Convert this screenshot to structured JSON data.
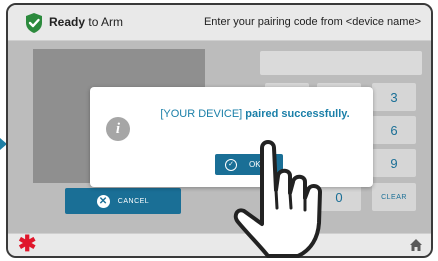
{
  "header": {
    "status_bold": "Ready",
    "status_rest": " to Arm",
    "prompt": "Enter your pairing code from <device name>"
  },
  "camera": {
    "cancel_label": "CANCEL"
  },
  "keypad": {
    "keys": [
      "",
      "",
      "3",
      "",
      "",
      "6",
      "",
      "",
      "9",
      "",
      "0",
      "CLEAR"
    ]
  },
  "modal": {
    "device_name": "[YOUR DEVICE]",
    "message_bold": "paired successfully.",
    "ok_label": "OK"
  },
  "colors": {
    "accent": "#1a6f96",
    "shield": "#2c8a3d",
    "alert": "#e0162b"
  },
  "icons": {
    "status": "shield-check-icon",
    "info": "info-icon",
    "cancel": "close-circle-icon",
    "ok": "check-circle-icon",
    "panic": "asterisk-icon",
    "home": "home-icon",
    "pointer": "pointing-hand-icon"
  }
}
